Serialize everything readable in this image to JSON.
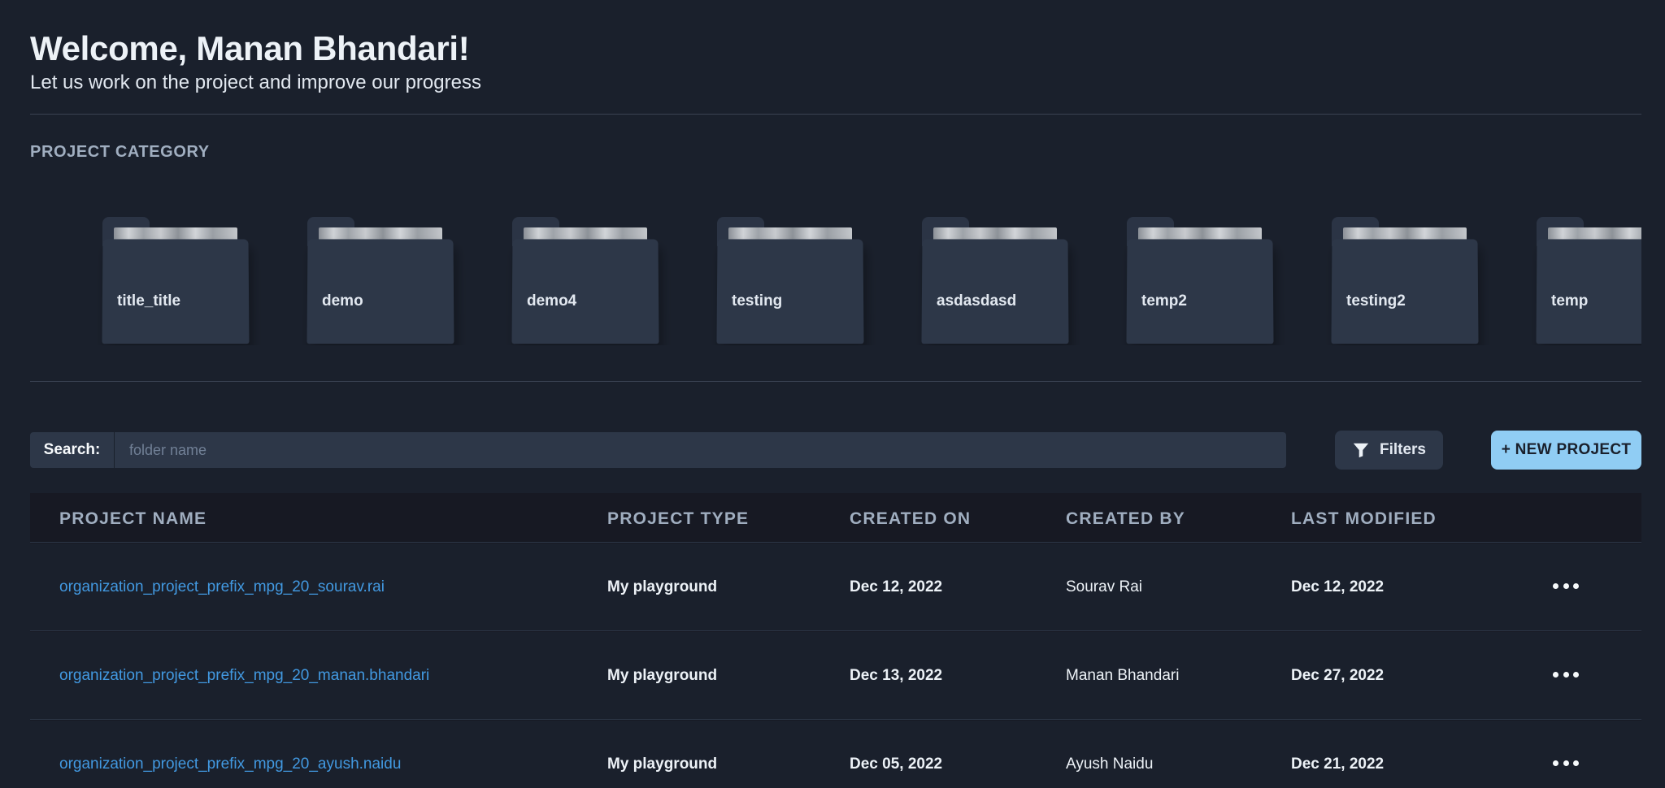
{
  "header": {
    "title": "Welcome, Manan Bhandari!",
    "subtitle": "Let us work on the project and improve our progress"
  },
  "categories": {
    "label": "PROJECT CATEGORY",
    "folders": [
      {
        "label": "title_title"
      },
      {
        "label": "demo"
      },
      {
        "label": "demo4"
      },
      {
        "label": "testing"
      },
      {
        "label": "asdasdasd"
      },
      {
        "label": "temp2"
      },
      {
        "label": "testing2"
      },
      {
        "label": "temp"
      }
    ]
  },
  "search": {
    "label": "Search:",
    "placeholder": "folder name",
    "value": ""
  },
  "toolbar": {
    "filters_label": "Filters",
    "filters_icon": "filter-icon",
    "new_project_label": "+ NEW PROJECT"
  },
  "table": {
    "columns": [
      "PROJECT NAME",
      "PROJECT TYPE",
      "CREATED ON",
      "CREATED BY",
      "LAST MODIFIED"
    ],
    "rows": [
      {
        "name": "organization_project_prefix_mpg_20_sourav.rai",
        "type": "My playground",
        "created_on": "Dec 12, 2022",
        "created_by": "Sourav Rai",
        "last_modified": "Dec 12, 2022"
      },
      {
        "name": "organization_project_prefix_mpg_20_manan.bhandari",
        "type": "My playground",
        "created_on": "Dec 13, 2022",
        "created_by": "Manan Bhandari",
        "last_modified": "Dec 27, 2022"
      },
      {
        "name": "organization_project_prefix_mpg_20_ayush.naidu",
        "type": "My playground",
        "created_on": "Dec 05, 2022",
        "created_by": "Ayush Naidu",
        "last_modified": "Dec 21, 2022"
      }
    ]
  },
  "colors": {
    "background": "#1a202c",
    "accent": "#90cdf4",
    "link": "#4299e1"
  }
}
